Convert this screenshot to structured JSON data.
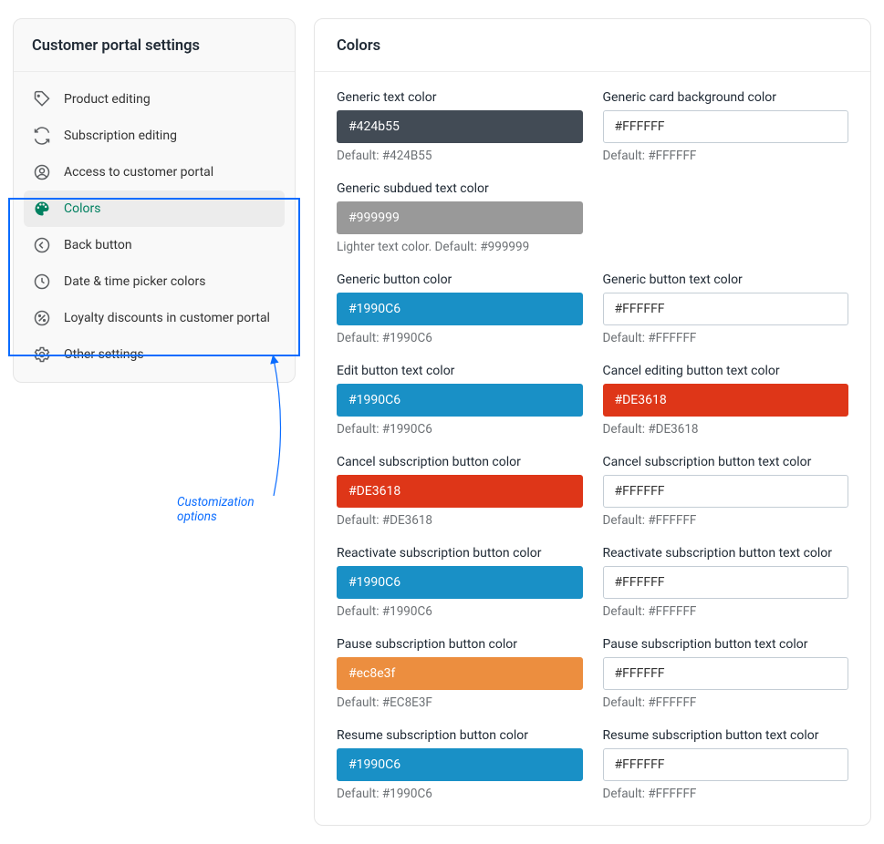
{
  "sidebar": {
    "title": "Customer portal settings",
    "items": [
      {
        "label": "Product editing"
      },
      {
        "label": "Subscription editing"
      },
      {
        "label": "Access to customer portal"
      },
      {
        "label": "Colors"
      },
      {
        "label": "Back button"
      },
      {
        "label": "Date & time picker colors"
      },
      {
        "label": "Loyalty discounts in customer portal"
      },
      {
        "label": "Other settings"
      }
    ]
  },
  "annotation": "Customization options",
  "panel": {
    "title": "Colors",
    "fields": {
      "genericText": {
        "label": "Generic text color",
        "value": "#424b55",
        "helper": "Default: #424B55"
      },
      "genericCardBg": {
        "label": "Generic card background color",
        "value": "#FFFFFF",
        "helper": "Default: #FFFFFF"
      },
      "genericSubdued": {
        "label": "Generic subdued text color",
        "value": "#999999",
        "helper": "Lighter text color. Default: #999999"
      },
      "genericButton": {
        "label": "Generic button color",
        "value": "#1990C6",
        "helper": "Default: #1990C6"
      },
      "genericButtonText": {
        "label": "Generic button text color",
        "value": "#FFFFFF",
        "helper": "Default: #FFFFFF"
      },
      "editButtonText": {
        "label": "Edit button text color",
        "value": "#1990C6",
        "helper": "Default: #1990C6"
      },
      "cancelEditingText": {
        "label": "Cancel editing button text color",
        "value": "#DE3618",
        "helper": "Default: #DE3618"
      },
      "cancelSub": {
        "label": "Cancel subscription button color",
        "value": "#DE3618",
        "helper": "Default: #DE3618"
      },
      "cancelSubText": {
        "label": "Cancel subscription button text color",
        "value": "#FFFFFF",
        "helper": "Default: #FFFFFF"
      },
      "reactivateSub": {
        "label": "Reactivate subscription button color",
        "value": "#1990C6",
        "helper": "Default: #1990C6"
      },
      "reactivateSubText": {
        "label": "Reactivate subscription button text color",
        "value": "#FFFFFF",
        "helper": "Default: #FFFFFF"
      },
      "pauseSub": {
        "label": "Pause subscription button color",
        "value": "#ec8e3f",
        "helper": "Default: #EC8E3F"
      },
      "pauseSubText": {
        "label": "Pause subscription button text color",
        "value": "#FFFFFF",
        "helper": "Default: #FFFFFF"
      },
      "resumeSub": {
        "label": "Resume subscription button color",
        "value": "#1990C6",
        "helper": "Default: #1990C6"
      },
      "resumeSubText": {
        "label": "Resume subscription button text color",
        "value": "#FFFFFF",
        "helper": "Default: #FFFFFF"
      }
    }
  }
}
